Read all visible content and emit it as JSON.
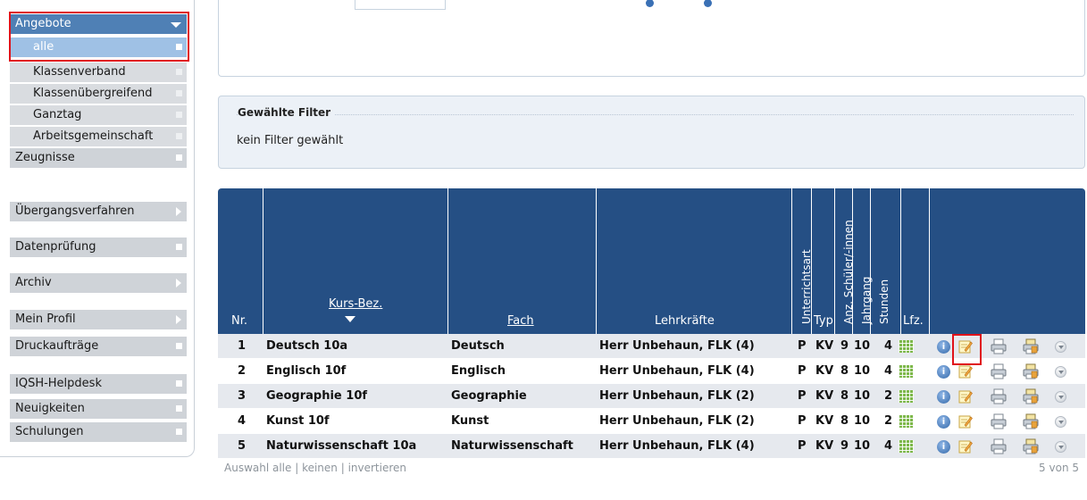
{
  "sidebar": {
    "items": [
      {
        "label": "Angebote",
        "state": "open"
      },
      {
        "label": "Zeugnisse",
        "state": "leaf"
      },
      {
        "label": "Übergangsverfahren",
        "state": "closed"
      },
      {
        "label": "Datenprüfung",
        "state": "leaf"
      },
      {
        "label": "Archiv",
        "state": "closed"
      },
      {
        "label": "Mein Profil",
        "state": "closed"
      },
      {
        "label": "Druckaufträge",
        "state": "leaf"
      },
      {
        "label": "IQSH-Helpdesk",
        "state": "leaf"
      },
      {
        "label": "Neuigkeiten",
        "state": "leaf"
      },
      {
        "label": "Schulungen",
        "state": "leaf"
      }
    ],
    "subitems": [
      {
        "label": "alle",
        "selected": true
      },
      {
        "label": "Klassenverband",
        "selected": false
      },
      {
        "label": "Klassenübergreifend",
        "selected": false
      },
      {
        "label": "Ganztag",
        "selected": false
      },
      {
        "label": "Arbeitsgemeinschaft",
        "selected": false
      }
    ]
  },
  "filter": {
    "legend": "Gewählte Filter",
    "text": "kein Filter gewählt"
  },
  "table": {
    "headers": {
      "nr": "Nr.",
      "kurs": "Kurs-Bez.",
      "fach": "Fach",
      "lehrkraefte": "Lehrkräfte",
      "unterrichtsart": "Unterrichtsart",
      "typ": "Typ",
      "anzahl": "Anz. Schüler/-innen",
      "jahrgang": "Jahrgang",
      "stunden": "Stunden",
      "lfz": "Lfz."
    },
    "rows": [
      {
        "nr": "1",
        "kurs": "Deutsch 10a",
        "fach": "Deutsch",
        "lehrkraefte": "Herr Unbehaun, FLK (4)",
        "art": "P",
        "typ": "KV",
        "anzahl": "9",
        "jahrgang": "10",
        "stunden": "4"
      },
      {
        "nr": "2",
        "kurs": "Englisch 10f",
        "fach": "Englisch",
        "lehrkraefte": "Herr Unbehaun, FLK (4)",
        "art": "P",
        "typ": "KV",
        "anzahl": "8",
        "jahrgang": "10",
        "stunden": "4"
      },
      {
        "nr": "3",
        "kurs": "Geographie 10f",
        "fach": "Geographie",
        "lehrkraefte": "Herr Unbehaun, FLK (2)",
        "art": "P",
        "typ": "KV",
        "anzahl": "8",
        "jahrgang": "10",
        "stunden": "2"
      },
      {
        "nr": "4",
        "kurs": "Kunst 10f",
        "fach": "Kunst",
        "lehrkraefte": "Herr Unbehaun, FLK (2)",
        "art": "P",
        "typ": "KV",
        "anzahl": "8",
        "jahrgang": "10",
        "stunden": "2"
      },
      {
        "nr": "5",
        "kurs": "Naturwissenschaft 10a",
        "fach": "Naturwissenschaft",
        "lehrkraefte": "Herr Unbehaun, FLK (4)",
        "art": "P",
        "typ": "KV",
        "anzahl": "9",
        "jahrgang": "10",
        "stunden": "4"
      }
    ],
    "footer": {
      "select": "Auswahl alle | keinen | invertieren",
      "count": "5 von 5"
    },
    "icons": [
      "lernfortschritt-grid-icon",
      "info-icon",
      "edit-icon",
      "print-icon",
      "print-report-icon",
      "more-icon"
    ]
  },
  "colors": {
    "header_bg": "#254f84",
    "nav_active": "#4f80b5",
    "sub_active": "#9fc1e5",
    "highlight": "#e0121a"
  }
}
